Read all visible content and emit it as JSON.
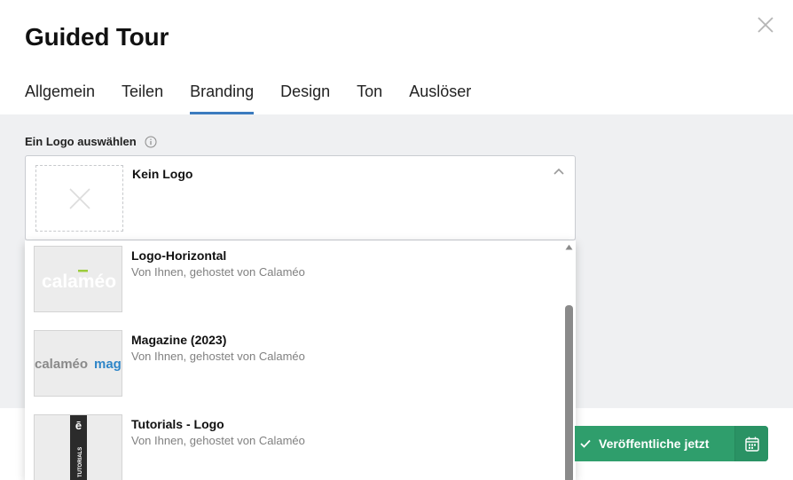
{
  "modal": {
    "title": "Guided Tour"
  },
  "tabs": [
    {
      "label": "Allgemein",
      "active": false
    },
    {
      "label": "Teilen",
      "active": false
    },
    {
      "label": "Branding",
      "active": true
    },
    {
      "label": "Design",
      "active": false
    },
    {
      "label": "Ton",
      "active": false
    },
    {
      "label": "Auslöser",
      "active": false
    }
  ],
  "logo_select": {
    "label": "Ein Logo auswählen",
    "selected": "Kein Logo",
    "options": [
      {
        "title": "Logo-Horizontal",
        "subtitle": "Von Ihnen, gehostet von Calaméo",
        "thumb_text": "calaméo"
      },
      {
        "title": "Magazine (2023)",
        "subtitle": "Von Ihnen, gehostet von Calaméo",
        "thumb_text": "calaméo",
        "thumb_text2": "mag"
      },
      {
        "title": "Tutorials - Logo",
        "subtitle": "Von Ihnen, gehostet von Calaméo",
        "thumb_text": "ē",
        "thumb_text2": "TUTORIALS"
      }
    ]
  },
  "publish": {
    "label": "Veröffentliche jetzt"
  },
  "colors": {
    "accent": "#3b7bbf",
    "publish_green": "#2f9e6c",
    "content_bg": "#eff0f2"
  },
  "icons": {
    "close": "close-icon",
    "info": "info-icon",
    "chevron": "chevron-up-icon",
    "check": "check-icon",
    "calendar": "calendar-icon"
  }
}
